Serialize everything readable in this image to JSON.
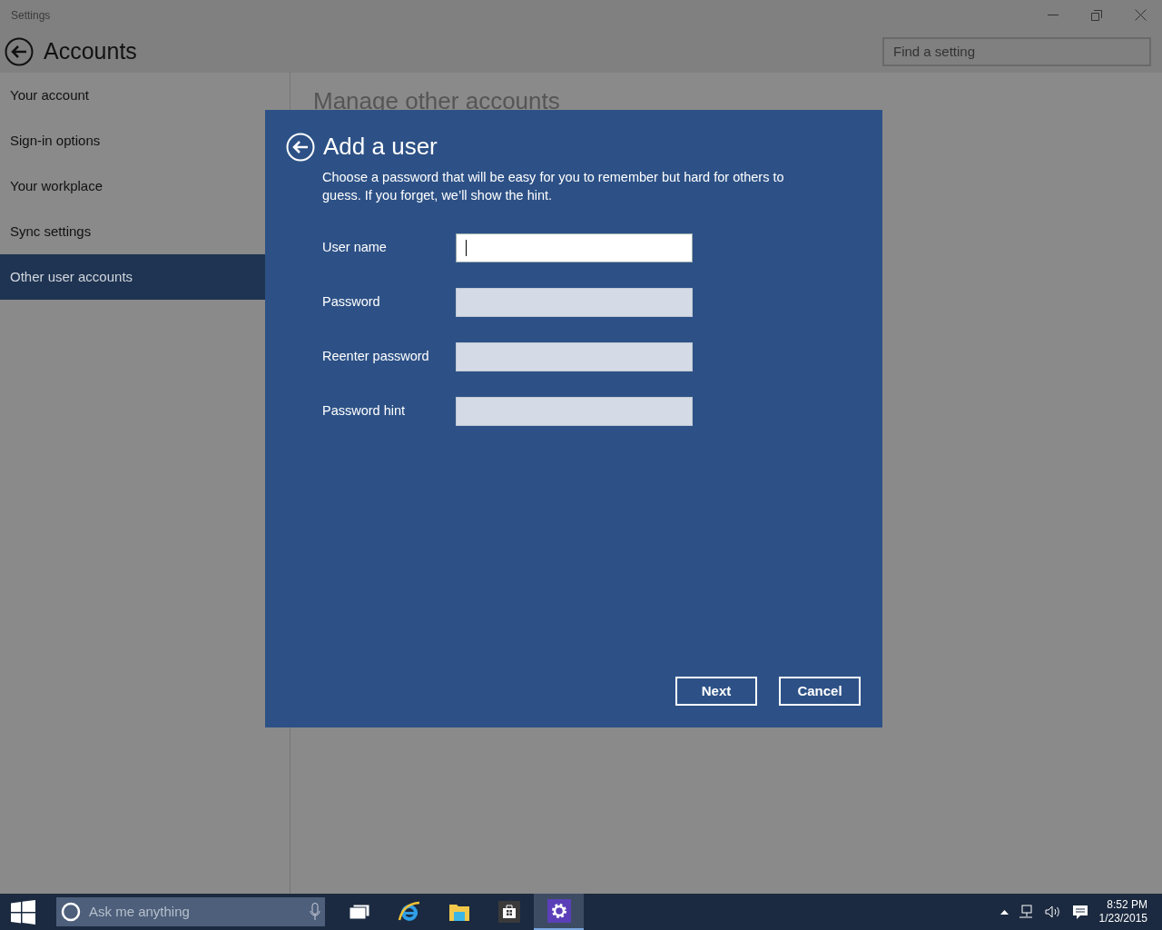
{
  "window": {
    "title": "Settings"
  },
  "header": {
    "title": "Accounts",
    "search": {
      "placeholder": "Find a setting"
    }
  },
  "sidebar": {
    "items": [
      {
        "label": "Your account",
        "selected": false
      },
      {
        "label": "Sign-in options",
        "selected": false
      },
      {
        "label": "Your workplace",
        "selected": false
      },
      {
        "label": "Sync settings",
        "selected": false
      },
      {
        "label": "Other user accounts",
        "selected": true
      }
    ]
  },
  "content": {
    "heading": "Manage other accounts"
  },
  "dialog": {
    "title": "Add a user",
    "description": "Choose a password that will be easy for you to remember but hard for others to guess. If you forget, we’ll show the hint.",
    "fields": [
      {
        "label": "User name",
        "focused": true
      },
      {
        "label": "Password",
        "focused": false
      },
      {
        "label": "Reenter password",
        "focused": false
      },
      {
        "label": "Password hint",
        "focused": false
      }
    ],
    "buttons": [
      "Next",
      "Cancel"
    ]
  },
  "taskbar": {
    "search": {
      "placeholder": "Ask me anything"
    },
    "apps": [
      {
        "kind": "taskview",
        "selected": false
      },
      {
        "kind": "browser",
        "selected": false
      },
      {
        "kind": "folder",
        "selected": false
      },
      {
        "kind": "store",
        "selected": false
      },
      {
        "kind": "settings",
        "selected": true
      }
    ],
    "clock": {
      "time": "8:52 PM",
      "date": "1/23/2015"
    }
  }
}
